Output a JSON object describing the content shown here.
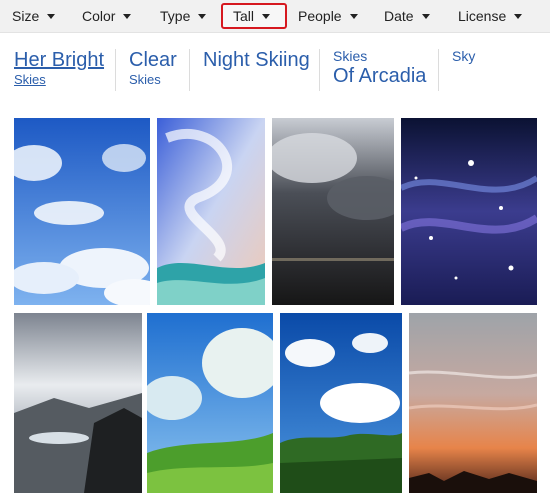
{
  "filters": [
    {
      "label": "Size"
    },
    {
      "label": "Color"
    },
    {
      "label": "Type"
    },
    {
      "label": "Tall"
    },
    {
      "label": "People"
    },
    {
      "label": "Date"
    },
    {
      "label": "License"
    }
  ],
  "related": [
    {
      "main": "Her Bright",
      "sub": "Skies"
    },
    {
      "main": "Clear",
      "sub": "Skies"
    },
    {
      "main": "Night Skiing",
      "sub": ""
    },
    {
      "pre": "Skies",
      "main": "Of Arcadia"
    },
    {
      "pre": "Sky"
    }
  ],
  "accent_link": "#2b5eab",
  "active_filter_border": "#d6181f",
  "images": [
    "blue-sky-clouds",
    "painted-wave-sky",
    "stormy-clouds-sea",
    "starry-space",
    "mountain-clouds",
    "green-field-sky",
    "trees-cumulus-sky",
    "sunset-sky"
  ]
}
